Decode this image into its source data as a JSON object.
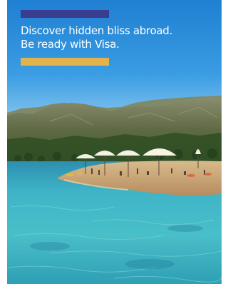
{
  "ad": {
    "headline_line1": "Discover hidden bliss abroad.",
    "headline_line2": "Be ready with Visa."
  },
  "colors": {
    "sky_top": "#1f84d6",
    "sky_bottom": "#5fb3ea",
    "accent_bar_top": "#3a3d8f",
    "accent_bar_bottom": "#e2b24c",
    "sea": "#3fb4c7",
    "sea_deep": "#2b8fb0",
    "mountain": "#6f7654",
    "beach": "#c8a77a"
  }
}
